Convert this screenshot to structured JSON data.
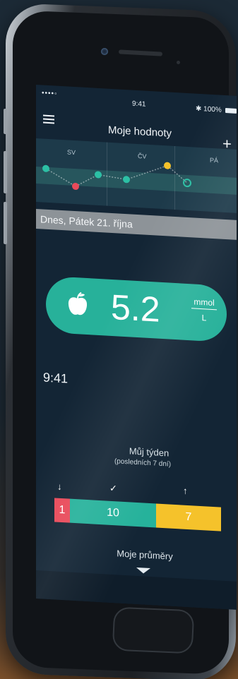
{
  "status_bar": {
    "signal": "••••◦",
    "time": "9:41",
    "battery": "100%"
  },
  "nav": {
    "title": "Moje hodnoty",
    "add_label": "+"
  },
  "mini_chart": {
    "days": [
      "SV",
      "ČV",
      "PÁ"
    ],
    "points": [
      {
        "value": 5.6,
        "status": "ok"
      },
      {
        "value": 4.6,
        "status": "low"
      },
      {
        "value": 5.4,
        "status": "ok"
      },
      {
        "value": 5.2,
        "status": "ok"
      },
      {
        "value": 6.2,
        "status": "high"
      },
      {
        "value": 5.2,
        "status": "current"
      }
    ],
    "colors": {
      "ok": "#2cc0a5",
      "low": "#e94a5a",
      "high": "#f5c22b"
    }
  },
  "date_bar": {
    "label": "Dnes, Pátek 21. října"
  },
  "reading": {
    "icon": "apple-icon",
    "value": "5.2",
    "unit_top": "mmol",
    "unit_bottom": "L",
    "time": "9:41"
  },
  "week": {
    "title": "Můj týden",
    "subtitle": "(posledních 7 dní)",
    "markers": {
      "low": "↓",
      "ok": "✓",
      "high": "↑"
    },
    "low_count": "1",
    "ok_count": "10",
    "high_count": "7",
    "averages_label": "Moje průměry"
  },
  "colors": {
    "accent": "#27b19a",
    "low": "#e94a5a",
    "high": "#f5c22b",
    "background": "#132535"
  }
}
